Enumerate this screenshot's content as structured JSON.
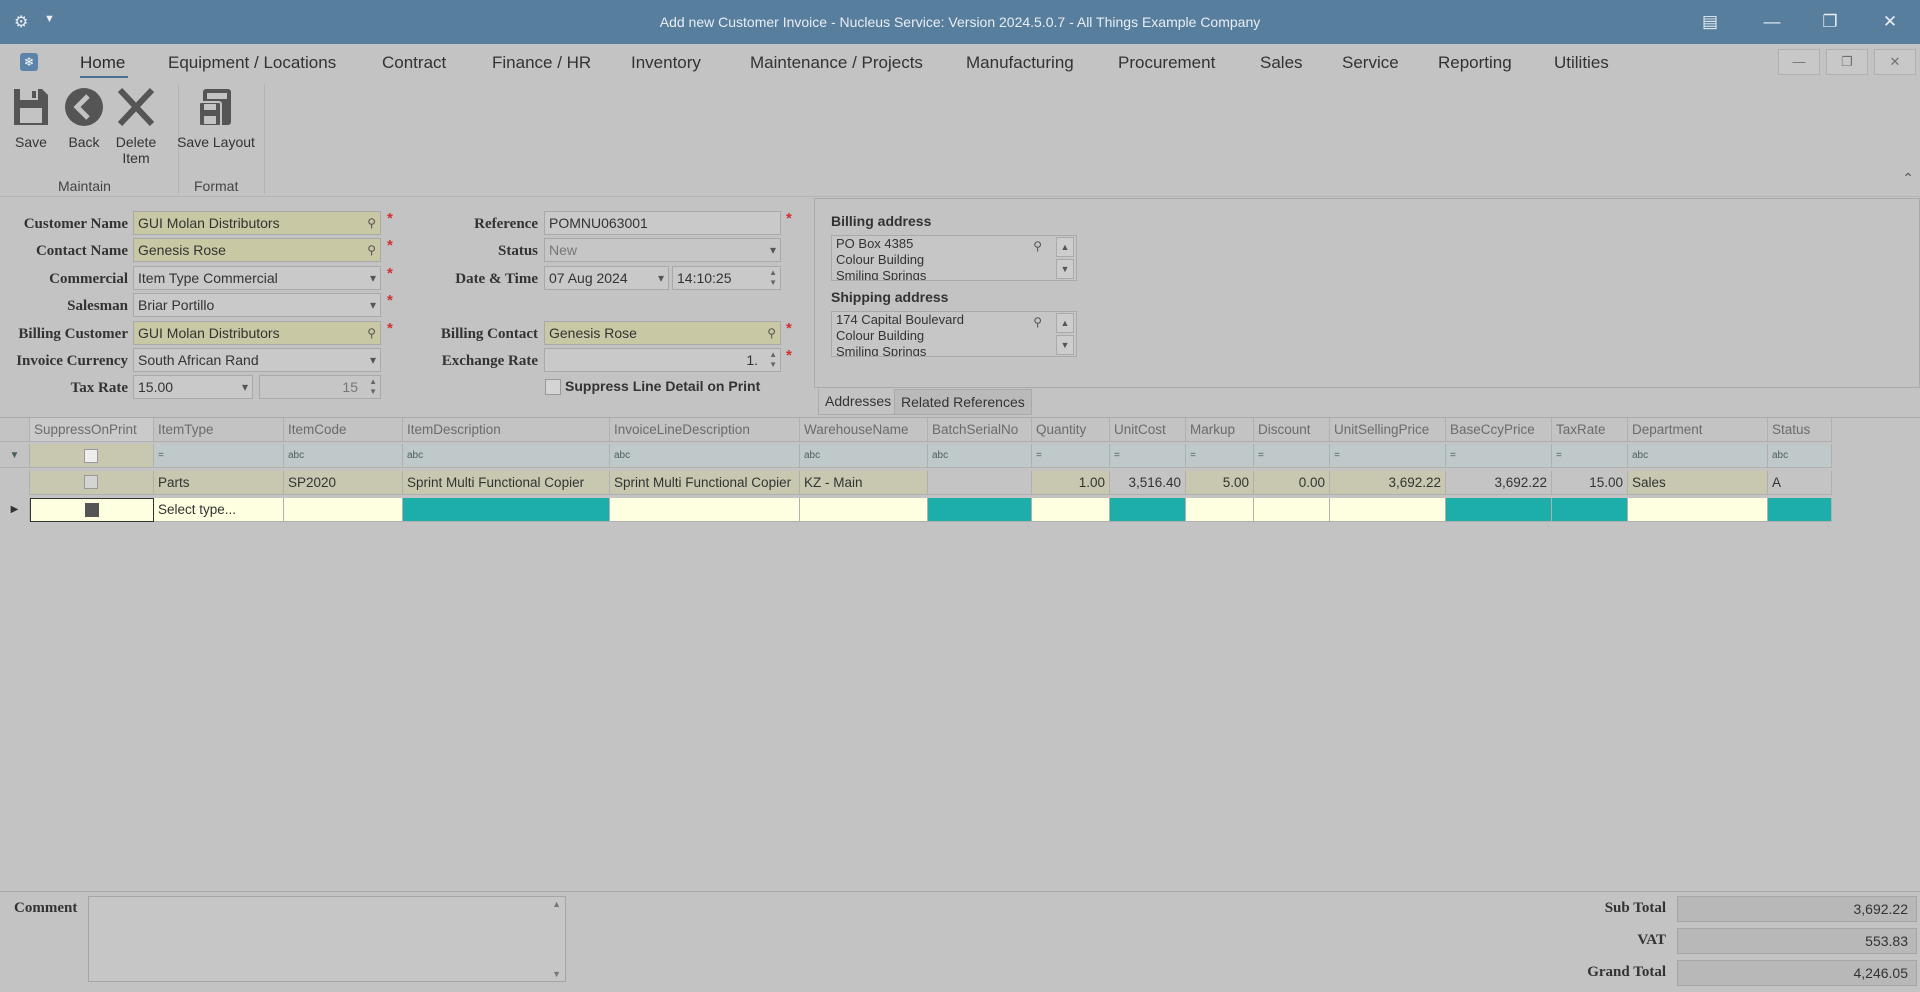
{
  "window": {
    "title": "Add new Customer Invoice - Nucleus Service: Version 2024.5.0.7 - All Things Example Company"
  },
  "menu": {
    "items": [
      "Home",
      "Equipment / Locations",
      "Contract",
      "Finance / HR",
      "Inventory",
      "Maintenance / Projects",
      "Manufacturing",
      "Procurement",
      "Sales",
      "Service",
      "Reporting",
      "Utilities"
    ],
    "active": "Home"
  },
  "ribbon": {
    "save": "Save",
    "back": "Back",
    "delete_line1": "Delete",
    "delete_line2": "Item",
    "save_layout": "Save Layout",
    "group_maintain": "Maintain",
    "group_format": "Format"
  },
  "form": {
    "customer_name_label": "Customer Name",
    "customer_name": "GUI Molan Distributors",
    "contact_name_label": "Contact Name",
    "contact_name": "Genesis Rose",
    "commercial_label": "Commercial",
    "commercial": "Item Type Commercial",
    "salesman_label": "Salesman",
    "salesman": "Briar Portillo",
    "billing_customer_label": "Billing Customer",
    "billing_customer": "GUI Molan Distributors",
    "invoice_currency_label": "Invoice Currency",
    "invoice_currency": "South African Rand",
    "tax_rate_label": "Tax Rate",
    "tax_rate": "15.00",
    "tax_rate_value": "15",
    "reference_label": "Reference",
    "reference": "POMNU063001",
    "status_label": "Status",
    "status": "New",
    "datetime_label": "Date & Time",
    "date": "07 Aug 2024",
    "time": "14:10:25",
    "billing_contact_label": "Billing Contact",
    "billing_contact": "Genesis Rose",
    "exchange_rate_label": "Exchange Rate",
    "exchange_rate": "1.",
    "suppress_label": "Suppress Line Detail on Print"
  },
  "addresses": {
    "billing_title": "Billing address",
    "billing_lines": [
      "PO Box 4385",
      "Colour Building",
      "Smiling Springs"
    ],
    "shipping_title": "Shipping address",
    "shipping_lines": [
      "174 Capital Boulevard",
      "Colour Building",
      "Smiling Springs"
    ],
    "tabs": [
      "Addresses",
      "Related References"
    ]
  },
  "grid": {
    "columns": [
      "SuppressOnPrint",
      "ItemType",
      "ItemCode",
      "ItemDescription",
      "InvoiceLineDescription",
      "WarehouseName",
      "BatchSerialNo",
      "Quantity",
      "UnitCost",
      "Markup",
      "Discount",
      "UnitSellingPrice",
      "BaseCcyPrice",
      "TaxRate",
      "Department",
      "Status"
    ],
    "filter_icons": [
      "",
      "=",
      "abc",
      "abc",
      "abc",
      "abc",
      "abc",
      "=",
      "=",
      "=",
      "=",
      "=",
      "=",
      "=",
      "abc",
      "abc"
    ],
    "rows": [
      [
        "",
        "Parts",
        "SP2020",
        "Sprint Multi Functional Copier",
        "Sprint Multi Functional Copier",
        "KZ - Main",
        "",
        "1.00",
        "3,516.40",
        "5.00",
        "0.00",
        "3,692.22",
        "3,692.22",
        "15.00",
        "Sales",
        "A"
      ]
    ],
    "new_row_placeholder": "Select type..."
  },
  "footer": {
    "comment_label": "Comment",
    "comment": "",
    "subtotal_label": "Sub Total",
    "subtotal": "3,692.22",
    "vat_label": "VAT",
    "vat": "553.83",
    "grand_total_label": "Grand Total",
    "grand_total": "4,246.05"
  }
}
